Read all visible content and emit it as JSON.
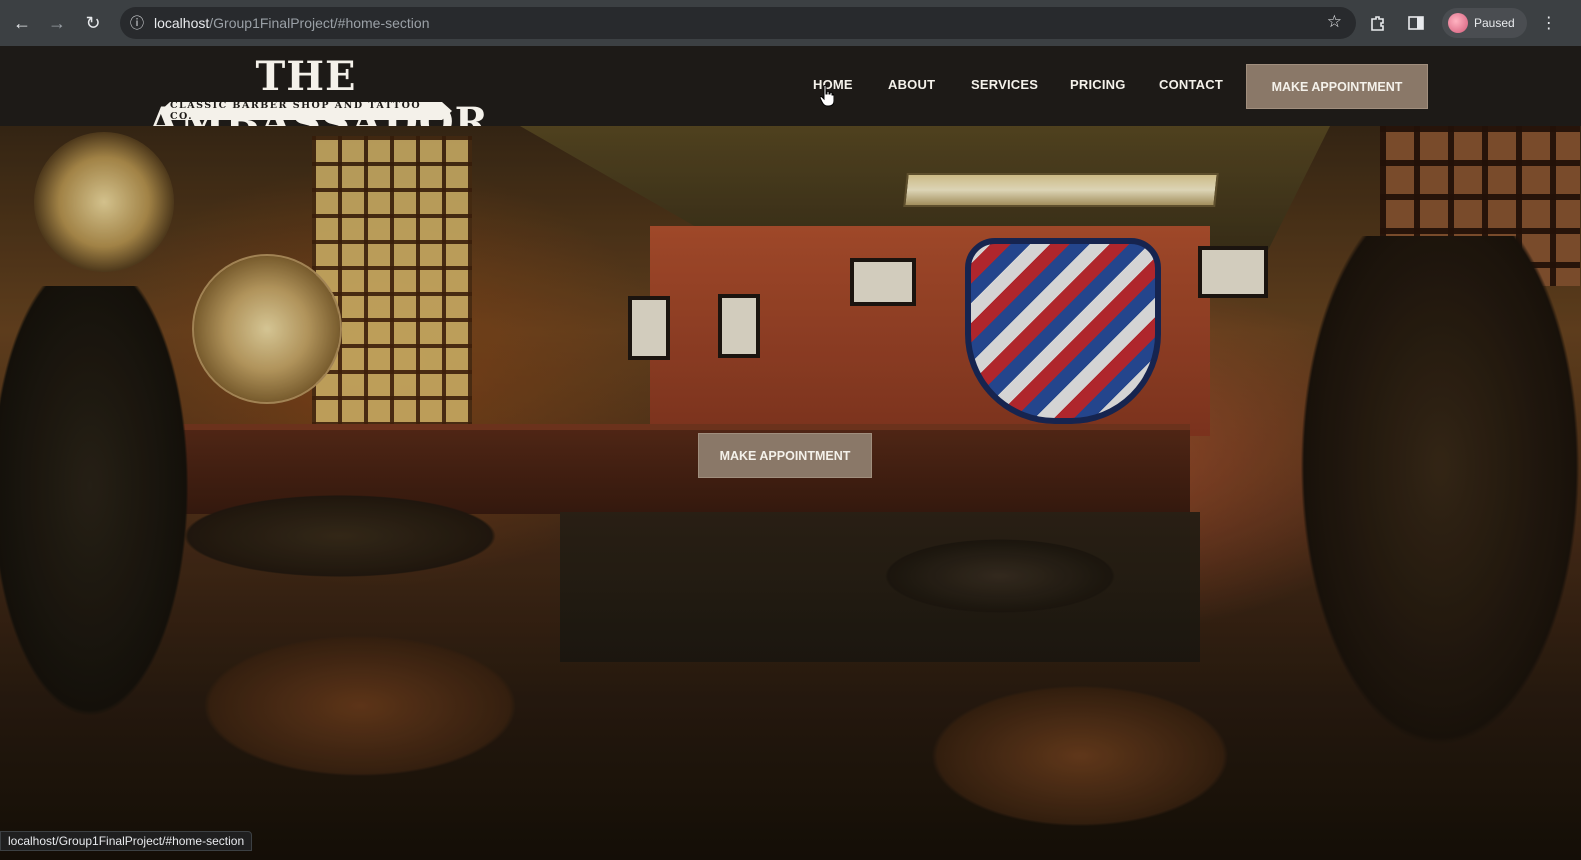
{
  "browser": {
    "url_host": "localhost",
    "url_path": "/Group1FinalProject/#home-section",
    "profile_label": "Paused",
    "icons": [
      "back-arrow-icon",
      "forward-arrow-icon",
      "reload-icon",
      "site-info-icon",
      "star-icon",
      "extensions-icon",
      "side-panel-icon",
      "kebab-menu-icon"
    ]
  },
  "site": {
    "logo_title": "THE AMBASSADOR",
    "logo_subtitle": "CLASSIC BARBER SHOP AND TATTOO CO.",
    "nav": {
      "home": "HOME",
      "about": "ABOUT",
      "services": "SERVICES",
      "pricing": "PRICING",
      "contact": "CONTACT",
      "cta": "MAKE APPOINTMENT"
    },
    "hero": {
      "cta": "MAKE APPOINTMENT"
    }
  },
  "status_bar": {
    "link_preview": "localhost/Group1FinalProject/#home-section"
  },
  "colors": {
    "cta_bg": "#8a7868",
    "header_bg": "#1d1a17",
    "chrome_bg": "#3c4043"
  }
}
